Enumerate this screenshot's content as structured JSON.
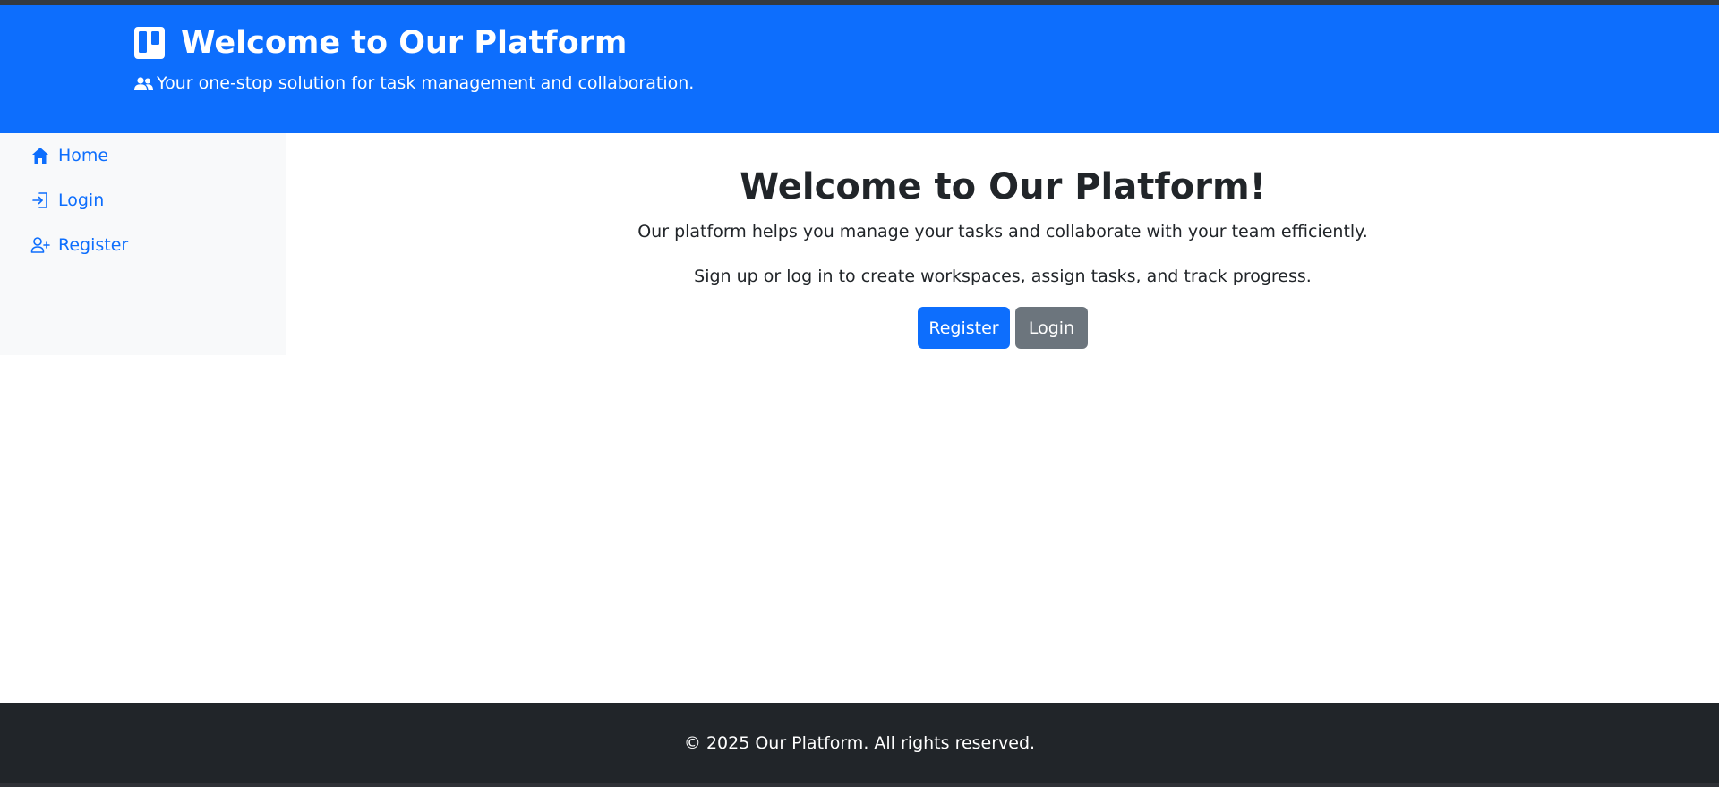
{
  "header": {
    "title": "Welcome to Our Platform",
    "subtitle": "Your one-stop solution for task management and collaboration.",
    "logo_icon": "kanban-board-icon",
    "subtitle_icon": "users-icon"
  },
  "sidebar": {
    "items": [
      {
        "label": "Home",
        "icon": "home-icon"
      },
      {
        "label": "Login",
        "icon": "login-icon"
      },
      {
        "label": "Register",
        "icon": "user-plus-icon"
      }
    ]
  },
  "main": {
    "title": "Welcome to Our Platform!",
    "paragraph1": "Our platform helps you manage your tasks and collaborate with your team efficiently.",
    "paragraph2": "Sign up or log in to create workspaces, assign tasks, and track progress.",
    "register_button": "Register",
    "login_button": "Login"
  },
  "footer": {
    "text": "© 2025 Our Platform. All rights reserved."
  },
  "colors": {
    "primary": "#0d6efd",
    "secondary": "#6c757d",
    "dark": "#212529",
    "sidebar_bg": "#f8f9fa"
  }
}
